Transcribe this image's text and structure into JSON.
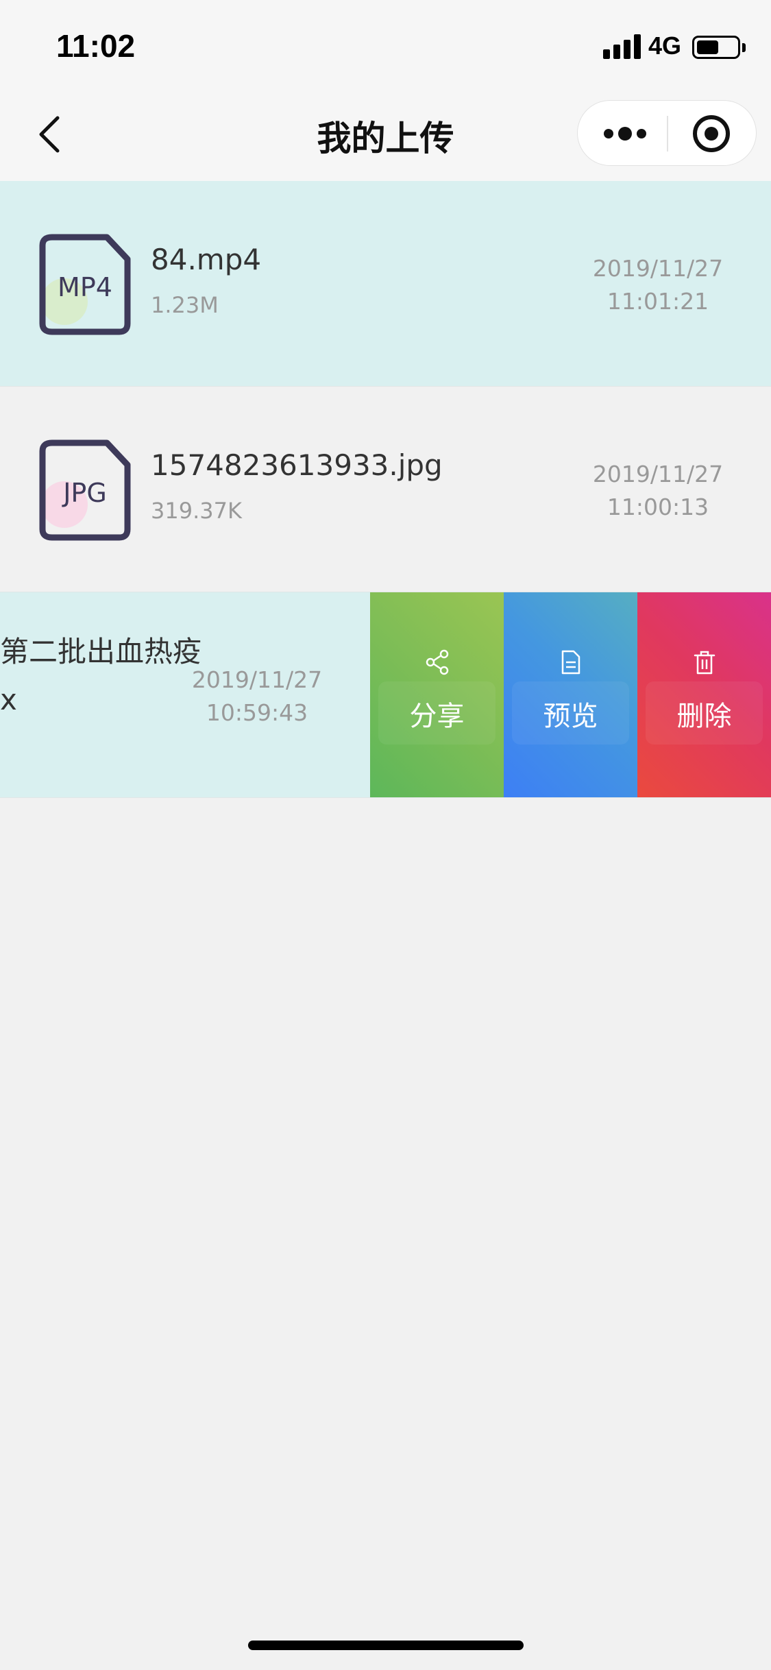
{
  "status_bar": {
    "time": "11:02",
    "network": "4G",
    "battery_level": 0.55
  },
  "nav": {
    "title": "我的上传",
    "back_icon": "chevron-left-icon",
    "more_icon": "more-dots-icon",
    "close_icon": "record-circle-icon"
  },
  "files": [
    {
      "type_label": "MP4",
      "name": "84.mp4",
      "size": "1.23M",
      "date": "2019/11/27",
      "time": "11:01:21",
      "icon": "file-mp4-icon"
    },
    {
      "type_label": "JPG",
      "name": "1574823613933.jpg",
      "size": "319.37K",
      "date": "2019/11/27",
      "time": "11:00:13",
      "icon": "file-jpg-icon"
    }
  ],
  "swiped_file": {
    "name_line1": "第二批出血热疫",
    "name_line2": "x",
    "date": "2019/11/27",
    "time": "10:59:43",
    "actions": {
      "share": {
        "label": "分享",
        "icon": "share-icon"
      },
      "preview": {
        "label": "预览",
        "icon": "document-icon"
      },
      "delete": {
        "label": "删除",
        "icon": "trash-icon"
      }
    }
  }
}
